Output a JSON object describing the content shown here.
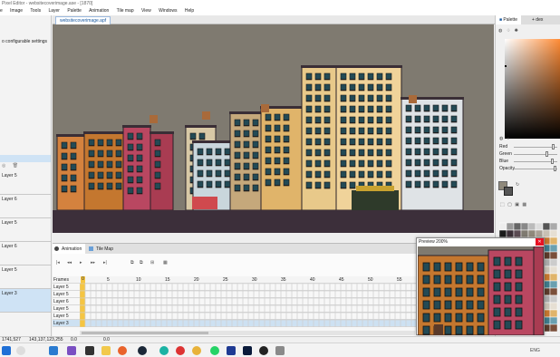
{
  "window": {
    "title": "Pixel Editor - websitecoverimage.ase - [1870]"
  },
  "menu": [
    "e",
    "Image",
    "Tools",
    "Layer",
    "Palette",
    "Animation",
    "Tile map",
    "View",
    "Windows",
    "Help"
  ],
  "left_panel": {
    "note": "o configurable settings",
    "layers": [
      "Layer 5",
      "Layer 6",
      "Layer 5",
      "Layer 6",
      "Layer 5",
      "Layer 3"
    ],
    "selected_index": 5
  },
  "document": {
    "tab_label": "websitecoverimage.apf"
  },
  "animation": {
    "tabs": [
      "Animation",
      "Tile Map"
    ],
    "frames_label": "Frames",
    "rows": [
      "Layer 5",
      "Layer 5",
      "Layer 6",
      "Layer 5",
      "Layer 5",
      "Layer 3"
    ],
    "selected_row": 5,
    "frame_numbers": [
      "0",
      "5",
      "10",
      "15",
      "20",
      "25",
      "30",
      "35",
      "40",
      "45",
      "50",
      "55"
    ]
  },
  "palette": {
    "tabs": [
      "Palette",
      "+ dex"
    ],
    "labels": [
      "Red",
      "Green",
      "Blue",
      "Opacity"
    ],
    "slider_levels": [
      0.93,
      0.78,
      0.9,
      0.98
    ],
    "accent": "#ff8a33"
  },
  "preview": {
    "title": "Preview 200%",
    "close_icon": "close-icon"
  },
  "status": {
    "cursor": "1741,527",
    "color": "143,137,123,255",
    "value1": "0.0",
    "value2": "0.0",
    "lang": "ENG"
  },
  "taskbar_icons": [
    "windows-icon",
    "search-icon",
    "vscode-icon",
    "visualstudio-icon",
    "terminal-icon",
    "explorer-icon",
    "firefox-icon",
    "steam-icon",
    "edge-icon",
    "media-icon",
    "chrome-icon",
    "whatsapp-icon",
    "powershell-icon",
    "photoshop-icon",
    "app-icon",
    "appicon-2"
  ]
}
